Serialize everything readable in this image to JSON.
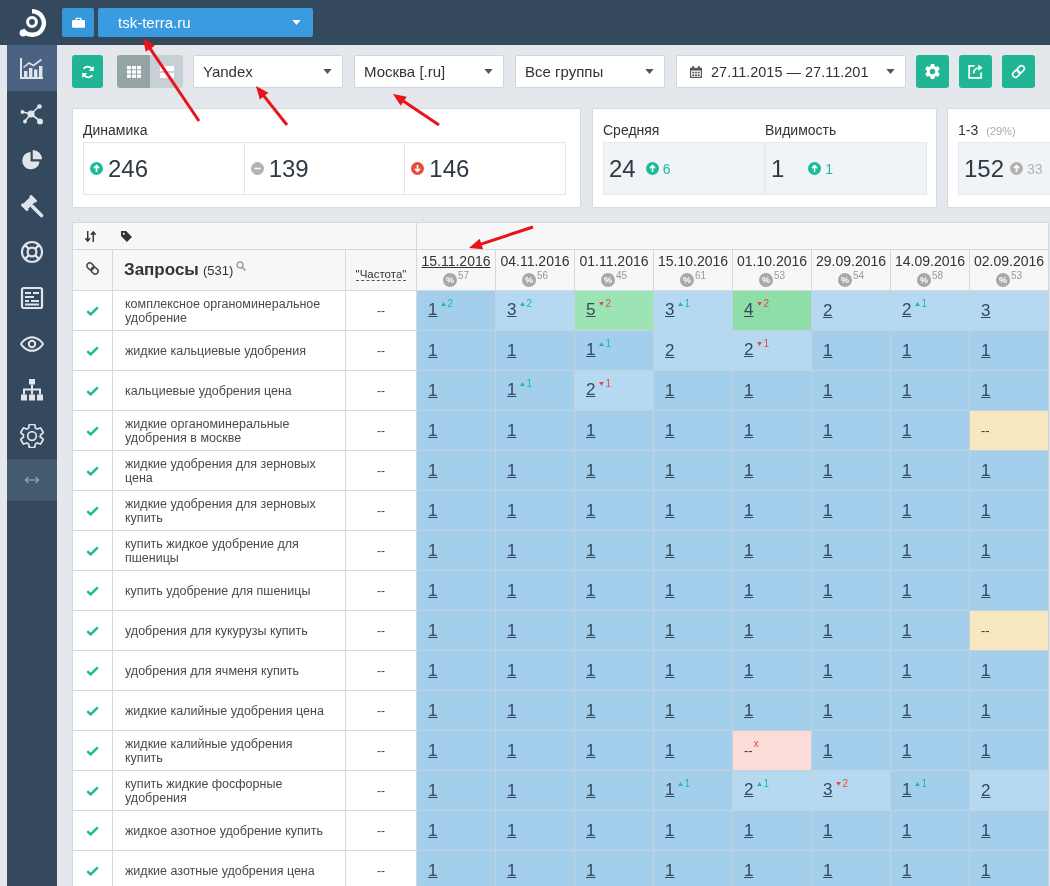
{
  "topbar": {
    "site": "tsk-terra.ru"
  },
  "sidebar": {
    "items": [
      {
        "kind": "analytics",
        "selected": true
      },
      {
        "kind": "clusters",
        "selected": false
      },
      {
        "kind": "pie",
        "selected": false
      },
      {
        "kind": "gavel",
        "selected": false
      },
      {
        "kind": "support",
        "selected": false
      },
      {
        "kind": "report",
        "selected": false
      },
      {
        "kind": "eye",
        "selected": false
      },
      {
        "kind": "sitemap",
        "selected": false
      },
      {
        "kind": "settings",
        "selected": false
      }
    ]
  },
  "toolbar": {
    "view_modes": [
      {
        "kind": "grid",
        "selected": true
      },
      {
        "kind": "rows",
        "selected": false
      }
    ],
    "filters": [
      {
        "kind": "select",
        "value": "Yandex"
      },
      {
        "kind": "select",
        "value": "Москва [.ru]"
      },
      {
        "kind": "select",
        "value": "Все группы"
      },
      {
        "kind": "date",
        "value": "27.11.2015 — 27.11.201"
      }
    ]
  },
  "stats": {
    "dynamics": {
      "title": "Динамика",
      "items": [
        {
          "kind": "up",
          "value": "246"
        },
        {
          "kind": "flat",
          "value": "139"
        },
        {
          "kind": "down",
          "value": "146"
        }
      ]
    },
    "average": {
      "items": [
        {
          "title": "Средняя",
          "value": "24",
          "kind": "up",
          "change": "6"
        },
        {
          "title": "Видимость",
          "value": "1",
          "kind": "up",
          "change": "1"
        }
      ]
    },
    "top": {
      "title": "1-3",
      "share": "(29%)",
      "value": "152",
      "kind": "muted_up",
      "change": "33"
    }
  },
  "table": {
    "columns": {
      "query": {
        "title": "Запросы",
        "count": "(531)"
      },
      "frequency": "\"Частота\""
    },
    "dates": [
      {
        "date": "15.11.2016",
        "selected": true,
        "badge": "%",
        "score": "57"
      },
      {
        "date": "04.11.2016",
        "selected": false,
        "badge": "%",
        "score": "56"
      },
      {
        "date": "01.11.2016",
        "selected": false,
        "badge": "%",
        "score": "45"
      },
      {
        "date": "15.10.2016",
        "selected": false,
        "badge": "%",
        "score": "61"
      },
      {
        "date": "01.10.2016",
        "selected": false,
        "badge": "%",
        "score": "53"
      },
      {
        "date": "29.09.2016",
        "selected": false,
        "badge": "%",
        "score": "54"
      },
      {
        "date": "14.09.2016",
        "selected": false,
        "badge": "%",
        "score": "58"
      },
      {
        "date": "02.09.2016",
        "selected": false,
        "badge": "%",
        "score": "53"
      }
    ],
    "rows": [
      {
        "checked": true,
        "query": "комплексное органоминеральное удобрение",
        "frequency": "--",
        "cells": [
          {
            "kind": "rise",
            "value": "1",
            "change": "2",
            "color": "#a3cfed"
          },
          {
            "kind": "rise",
            "value": "3",
            "change": "2",
            "color": "#b4d9f1"
          },
          {
            "kind": "fall",
            "value": "5",
            "change": "2",
            "color": "#9ce4b4"
          },
          {
            "kind": "rise",
            "value": "3",
            "change": "1",
            "color": "#b4d9f1"
          },
          {
            "kind": "fall",
            "value": "4",
            "change": "2",
            "color": "#8ddea8"
          },
          {
            "kind": "position",
            "value": "2",
            "color": "#b4d9f1"
          },
          {
            "kind": "rise",
            "value": "2",
            "change": "1",
            "color": "#b4d9f1"
          },
          {
            "kind": "position",
            "value": "3",
            "color": "#b4d9f1"
          }
        ]
      },
      {
        "checked": true,
        "query": "жидкие кальциевые удобрения",
        "frequency": "--",
        "cells": [
          {
            "kind": "position",
            "value": "1",
            "color": "#a3cfed"
          },
          {
            "kind": "position",
            "value": "1",
            "color": "#a3cfed"
          },
          {
            "kind": "rise",
            "value": "1",
            "change": "1",
            "color": "#a3cfed"
          },
          {
            "kind": "position",
            "value": "2",
            "color": "#b4d9f1"
          },
          {
            "kind": "fall",
            "value": "2",
            "change": "1",
            "color": "#b4d9f1"
          },
          {
            "kind": "position",
            "value": "1",
            "color": "#a3cfed"
          },
          {
            "kind": "position",
            "value": "1",
            "color": "#a3cfed"
          },
          {
            "kind": "position",
            "value": "1",
            "color": "#a3cfed"
          }
        ]
      },
      {
        "checked": true,
        "query": "кальциевые удобрения цена",
        "frequency": "--",
        "cells": [
          {
            "kind": "position",
            "value": "1",
            "color": "#a3cfed"
          },
          {
            "kind": "rise",
            "value": "1",
            "change": "1",
            "color": "#a3cfed"
          },
          {
            "kind": "fall",
            "value": "2",
            "change": "1",
            "color": "#b4d9f1"
          },
          {
            "kind": "position",
            "value": "1",
            "color": "#a3cfed"
          },
          {
            "kind": "position",
            "value": "1",
            "color": "#a3cfed"
          },
          {
            "kind": "position",
            "value": "1",
            "color": "#a3cfed"
          },
          {
            "kind": "position",
            "value": "1",
            "color": "#a3cfed"
          },
          {
            "kind": "position",
            "value": "1",
            "color": "#a3cfed"
          }
        ]
      },
      {
        "checked": true,
        "query": "жидкие органоминеральные удобрения в москве",
        "frequency": "--",
        "cells": [
          {
            "kind": "position",
            "value": "1",
            "color": "#a3cfed"
          },
          {
            "kind": "position",
            "value": "1",
            "color": "#a3cfed"
          },
          {
            "kind": "position",
            "value": "1",
            "color": "#a3cfed"
          },
          {
            "kind": "position",
            "value": "1",
            "color": "#a3cfed"
          },
          {
            "kind": "position",
            "value": "1",
            "color": "#a3cfed"
          },
          {
            "kind": "position",
            "value": "1",
            "color": "#a3cfed"
          },
          {
            "kind": "position",
            "value": "1",
            "color": "#a3cfed"
          },
          {
            "kind": "missing",
            "value": "--",
            "color": "#f8e8c2"
          }
        ]
      },
      {
        "checked": true,
        "query": "жидкие удобрения для зерновых цена",
        "frequency": "--",
        "cells": [
          {
            "kind": "position",
            "value": "1",
            "color": "#a3cfed"
          },
          {
            "kind": "position",
            "value": "1",
            "color": "#a3cfed"
          },
          {
            "kind": "position",
            "value": "1",
            "color": "#a3cfed"
          },
          {
            "kind": "position",
            "value": "1",
            "color": "#a3cfed"
          },
          {
            "kind": "position",
            "value": "1",
            "color": "#a3cfed"
          },
          {
            "kind": "position",
            "value": "1",
            "color": "#a3cfed"
          },
          {
            "kind": "position",
            "value": "1",
            "color": "#a3cfed"
          },
          {
            "kind": "position",
            "value": "1",
            "color": "#a3cfed"
          }
        ]
      },
      {
        "checked": true,
        "query": "жидкие удобрения для зерновых купить",
        "frequency": "--",
        "cells": [
          {
            "kind": "position",
            "value": "1",
            "color": "#a3cfed"
          },
          {
            "kind": "position",
            "value": "1",
            "color": "#a3cfed"
          },
          {
            "kind": "position",
            "value": "1",
            "color": "#a3cfed"
          },
          {
            "kind": "position",
            "value": "1",
            "color": "#a3cfed"
          },
          {
            "kind": "position",
            "value": "1",
            "color": "#a3cfed"
          },
          {
            "kind": "position",
            "value": "1",
            "color": "#a3cfed"
          },
          {
            "kind": "position",
            "value": "1",
            "color": "#a3cfed"
          },
          {
            "kind": "position",
            "value": "1",
            "color": "#a3cfed"
          }
        ]
      },
      {
        "checked": true,
        "query": "купить жидкое удобрение для пшеницы",
        "frequency": "--",
        "cells": [
          {
            "kind": "position",
            "value": "1",
            "color": "#a3cfed"
          },
          {
            "kind": "position",
            "value": "1",
            "color": "#a3cfed"
          },
          {
            "kind": "position",
            "value": "1",
            "color": "#a3cfed"
          },
          {
            "kind": "position",
            "value": "1",
            "color": "#a3cfed"
          },
          {
            "kind": "position",
            "value": "1",
            "color": "#a3cfed"
          },
          {
            "kind": "position",
            "value": "1",
            "color": "#a3cfed"
          },
          {
            "kind": "position",
            "value": "1",
            "color": "#a3cfed"
          },
          {
            "kind": "position",
            "value": "1",
            "color": "#a3cfed"
          }
        ]
      },
      {
        "checked": true,
        "query": "купить удобрение для пшеницы",
        "frequency": "--",
        "cells": [
          {
            "kind": "position",
            "value": "1",
            "color": "#a3cfed"
          },
          {
            "kind": "position",
            "value": "1",
            "color": "#a3cfed"
          },
          {
            "kind": "position",
            "value": "1",
            "color": "#a3cfed"
          },
          {
            "kind": "position",
            "value": "1",
            "color": "#a3cfed"
          },
          {
            "kind": "position",
            "value": "1",
            "color": "#a3cfed"
          },
          {
            "kind": "position",
            "value": "1",
            "color": "#a3cfed"
          },
          {
            "kind": "position",
            "value": "1",
            "color": "#a3cfed"
          },
          {
            "kind": "position",
            "value": "1",
            "color": "#a3cfed"
          }
        ]
      },
      {
        "checked": true,
        "query": "удобрения для кукурузы купить",
        "frequency": "--",
        "cells": [
          {
            "kind": "position",
            "value": "1",
            "color": "#a3cfed"
          },
          {
            "kind": "position",
            "value": "1",
            "color": "#a3cfed"
          },
          {
            "kind": "position",
            "value": "1",
            "color": "#a3cfed"
          },
          {
            "kind": "position",
            "value": "1",
            "color": "#a3cfed"
          },
          {
            "kind": "position",
            "value": "1",
            "color": "#a3cfed"
          },
          {
            "kind": "position",
            "value": "1",
            "color": "#a3cfed"
          },
          {
            "kind": "position",
            "value": "1",
            "color": "#a3cfed"
          },
          {
            "kind": "missing",
            "value": "--",
            "color": "#f8e8c2"
          }
        ]
      },
      {
        "checked": true,
        "query": "удобрения для ячменя купить",
        "frequency": "--",
        "cells": [
          {
            "kind": "position",
            "value": "1",
            "color": "#a3cfed"
          },
          {
            "kind": "position",
            "value": "1",
            "color": "#a3cfed"
          },
          {
            "kind": "position",
            "value": "1",
            "color": "#a3cfed"
          },
          {
            "kind": "position",
            "value": "1",
            "color": "#a3cfed"
          },
          {
            "kind": "position",
            "value": "1",
            "color": "#a3cfed"
          },
          {
            "kind": "position",
            "value": "1",
            "color": "#a3cfed"
          },
          {
            "kind": "position",
            "value": "1",
            "color": "#a3cfed"
          },
          {
            "kind": "position",
            "value": "1",
            "color": "#a3cfed"
          }
        ]
      },
      {
        "checked": true,
        "query": "жидкие калийные удобрения цена",
        "frequency": "--",
        "cells": [
          {
            "kind": "position",
            "value": "1",
            "color": "#a3cfed"
          },
          {
            "kind": "position",
            "value": "1",
            "color": "#a3cfed"
          },
          {
            "kind": "position",
            "value": "1",
            "color": "#a3cfed"
          },
          {
            "kind": "position",
            "value": "1",
            "color": "#a3cfed"
          },
          {
            "kind": "position",
            "value": "1",
            "color": "#a3cfed"
          },
          {
            "kind": "position",
            "value": "1",
            "color": "#a3cfed"
          },
          {
            "kind": "position",
            "value": "1",
            "color": "#a3cfed"
          },
          {
            "kind": "position",
            "value": "1",
            "color": "#a3cfed"
          }
        ]
      },
      {
        "checked": true,
        "query": "жидкие калийные удобрения купить",
        "frequency": "--",
        "cells": [
          {
            "kind": "position",
            "value": "1",
            "color": "#a3cfed"
          },
          {
            "kind": "position",
            "value": "1",
            "color": "#a3cfed"
          },
          {
            "kind": "position",
            "value": "1",
            "color": "#a3cfed"
          },
          {
            "kind": "position",
            "value": "1",
            "color": "#a3cfed"
          },
          {
            "kind": "lost",
            "value": "--",
            "change": "x",
            "color": "#fbdcd8"
          },
          {
            "kind": "position",
            "value": "1",
            "color": "#a3cfed"
          },
          {
            "kind": "position",
            "value": "1",
            "color": "#a3cfed"
          },
          {
            "kind": "position",
            "value": "1",
            "color": "#a3cfed"
          }
        ]
      },
      {
        "checked": true,
        "query": "купить жидкие фосфорные удобрения",
        "frequency": "--",
        "cells": [
          {
            "kind": "position",
            "value": "1",
            "color": "#a3cfed"
          },
          {
            "kind": "position",
            "value": "1",
            "color": "#a3cfed"
          },
          {
            "kind": "position",
            "value": "1",
            "color": "#a3cfed"
          },
          {
            "kind": "rise",
            "value": "1",
            "change": "1",
            "color": "#a3cfed"
          },
          {
            "kind": "rise",
            "value": "2",
            "change": "1",
            "color": "#b4d9f1"
          },
          {
            "kind": "fall",
            "value": "3",
            "change": "2",
            "color": "#b4d9f1"
          },
          {
            "kind": "rise",
            "value": "1",
            "change": "1",
            "color": "#a3cfed"
          },
          {
            "kind": "position",
            "value": "2",
            "color": "#b4d9f1"
          }
        ]
      },
      {
        "checked": true,
        "query": "жидкое азотное удобрение купить",
        "frequency": "--",
        "cells": [
          {
            "kind": "position",
            "value": "1",
            "color": "#a3cfed"
          },
          {
            "kind": "position",
            "value": "1",
            "color": "#a3cfed"
          },
          {
            "kind": "position",
            "value": "1",
            "color": "#a3cfed"
          },
          {
            "kind": "position",
            "value": "1",
            "color": "#a3cfed"
          },
          {
            "kind": "position",
            "value": "1",
            "color": "#a3cfed"
          },
          {
            "kind": "position",
            "value": "1",
            "color": "#a3cfed"
          },
          {
            "kind": "position",
            "value": "1",
            "color": "#a3cfed"
          },
          {
            "kind": "position",
            "value": "1",
            "color": "#a3cfed"
          }
        ]
      },
      {
        "checked": true,
        "query": "жидкие азотные удобрения цена",
        "frequency": "--",
        "cells": [
          {
            "kind": "position",
            "value": "1",
            "color": "#a3cfed"
          },
          {
            "kind": "position",
            "value": "1",
            "color": "#a3cfed"
          },
          {
            "kind": "position",
            "value": "1",
            "color": "#a3cfed"
          },
          {
            "kind": "position",
            "value": "1",
            "color": "#a3cfed"
          },
          {
            "kind": "position",
            "value": "1",
            "color": "#a3cfed"
          },
          {
            "kind": "position",
            "value": "1",
            "color": "#a3cfed"
          },
          {
            "kind": "position",
            "value": "1",
            "color": "#a3cfed"
          },
          {
            "kind": "position",
            "value": "1",
            "color": "#a3cfed"
          }
        ]
      }
    ]
  }
}
